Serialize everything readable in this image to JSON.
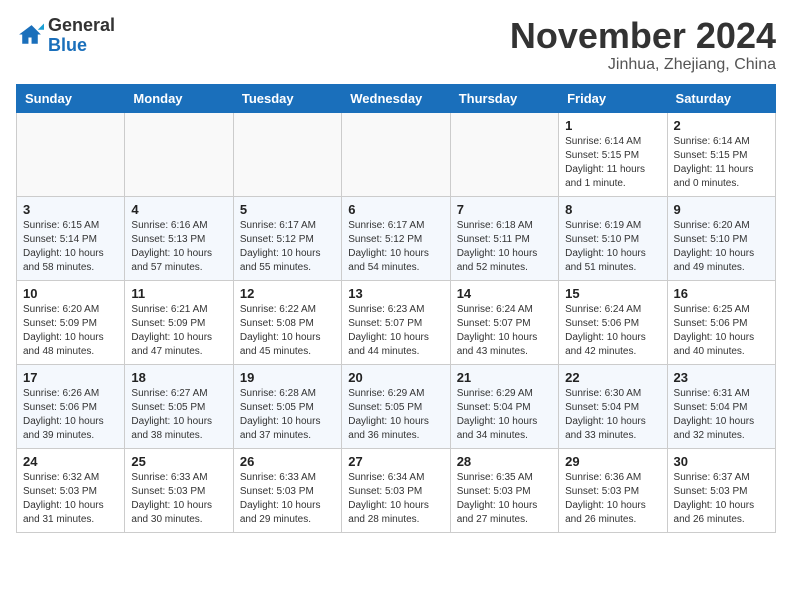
{
  "header": {
    "logo_line1": "General",
    "logo_line2": "Blue",
    "month_title": "November 2024",
    "location": "Jinhua, Zhejiang, China"
  },
  "calendar": {
    "days_of_week": [
      "Sunday",
      "Monday",
      "Tuesday",
      "Wednesday",
      "Thursday",
      "Friday",
      "Saturday"
    ],
    "weeks": [
      [
        {
          "day": "",
          "info": ""
        },
        {
          "day": "",
          "info": ""
        },
        {
          "day": "",
          "info": ""
        },
        {
          "day": "",
          "info": ""
        },
        {
          "day": "",
          "info": ""
        },
        {
          "day": "1",
          "info": "Sunrise: 6:14 AM\nSunset: 5:15 PM\nDaylight: 11 hours\nand 1 minute."
        },
        {
          "day": "2",
          "info": "Sunrise: 6:14 AM\nSunset: 5:15 PM\nDaylight: 11 hours\nand 0 minutes."
        }
      ],
      [
        {
          "day": "3",
          "info": "Sunrise: 6:15 AM\nSunset: 5:14 PM\nDaylight: 10 hours\nand 58 minutes."
        },
        {
          "day": "4",
          "info": "Sunrise: 6:16 AM\nSunset: 5:13 PM\nDaylight: 10 hours\nand 57 minutes."
        },
        {
          "day": "5",
          "info": "Sunrise: 6:17 AM\nSunset: 5:12 PM\nDaylight: 10 hours\nand 55 minutes."
        },
        {
          "day": "6",
          "info": "Sunrise: 6:17 AM\nSunset: 5:12 PM\nDaylight: 10 hours\nand 54 minutes."
        },
        {
          "day": "7",
          "info": "Sunrise: 6:18 AM\nSunset: 5:11 PM\nDaylight: 10 hours\nand 52 minutes."
        },
        {
          "day": "8",
          "info": "Sunrise: 6:19 AM\nSunset: 5:10 PM\nDaylight: 10 hours\nand 51 minutes."
        },
        {
          "day": "9",
          "info": "Sunrise: 6:20 AM\nSunset: 5:10 PM\nDaylight: 10 hours\nand 49 minutes."
        }
      ],
      [
        {
          "day": "10",
          "info": "Sunrise: 6:20 AM\nSunset: 5:09 PM\nDaylight: 10 hours\nand 48 minutes."
        },
        {
          "day": "11",
          "info": "Sunrise: 6:21 AM\nSunset: 5:09 PM\nDaylight: 10 hours\nand 47 minutes."
        },
        {
          "day": "12",
          "info": "Sunrise: 6:22 AM\nSunset: 5:08 PM\nDaylight: 10 hours\nand 45 minutes."
        },
        {
          "day": "13",
          "info": "Sunrise: 6:23 AM\nSunset: 5:07 PM\nDaylight: 10 hours\nand 44 minutes."
        },
        {
          "day": "14",
          "info": "Sunrise: 6:24 AM\nSunset: 5:07 PM\nDaylight: 10 hours\nand 43 minutes."
        },
        {
          "day": "15",
          "info": "Sunrise: 6:24 AM\nSunset: 5:06 PM\nDaylight: 10 hours\nand 42 minutes."
        },
        {
          "day": "16",
          "info": "Sunrise: 6:25 AM\nSunset: 5:06 PM\nDaylight: 10 hours\nand 40 minutes."
        }
      ],
      [
        {
          "day": "17",
          "info": "Sunrise: 6:26 AM\nSunset: 5:06 PM\nDaylight: 10 hours\nand 39 minutes."
        },
        {
          "day": "18",
          "info": "Sunrise: 6:27 AM\nSunset: 5:05 PM\nDaylight: 10 hours\nand 38 minutes."
        },
        {
          "day": "19",
          "info": "Sunrise: 6:28 AM\nSunset: 5:05 PM\nDaylight: 10 hours\nand 37 minutes."
        },
        {
          "day": "20",
          "info": "Sunrise: 6:29 AM\nSunset: 5:05 PM\nDaylight: 10 hours\nand 36 minutes."
        },
        {
          "day": "21",
          "info": "Sunrise: 6:29 AM\nSunset: 5:04 PM\nDaylight: 10 hours\nand 34 minutes."
        },
        {
          "day": "22",
          "info": "Sunrise: 6:30 AM\nSunset: 5:04 PM\nDaylight: 10 hours\nand 33 minutes."
        },
        {
          "day": "23",
          "info": "Sunrise: 6:31 AM\nSunset: 5:04 PM\nDaylight: 10 hours\nand 32 minutes."
        }
      ],
      [
        {
          "day": "24",
          "info": "Sunrise: 6:32 AM\nSunset: 5:03 PM\nDaylight: 10 hours\nand 31 minutes."
        },
        {
          "day": "25",
          "info": "Sunrise: 6:33 AM\nSunset: 5:03 PM\nDaylight: 10 hours\nand 30 minutes."
        },
        {
          "day": "26",
          "info": "Sunrise: 6:33 AM\nSunset: 5:03 PM\nDaylight: 10 hours\nand 29 minutes."
        },
        {
          "day": "27",
          "info": "Sunrise: 6:34 AM\nSunset: 5:03 PM\nDaylight: 10 hours\nand 28 minutes."
        },
        {
          "day": "28",
          "info": "Sunrise: 6:35 AM\nSunset: 5:03 PM\nDaylight: 10 hours\nand 27 minutes."
        },
        {
          "day": "29",
          "info": "Sunrise: 6:36 AM\nSunset: 5:03 PM\nDaylight: 10 hours\nand 26 minutes."
        },
        {
          "day": "30",
          "info": "Sunrise: 6:37 AM\nSunset: 5:03 PM\nDaylight: 10 hours\nand 26 minutes."
        }
      ]
    ]
  }
}
